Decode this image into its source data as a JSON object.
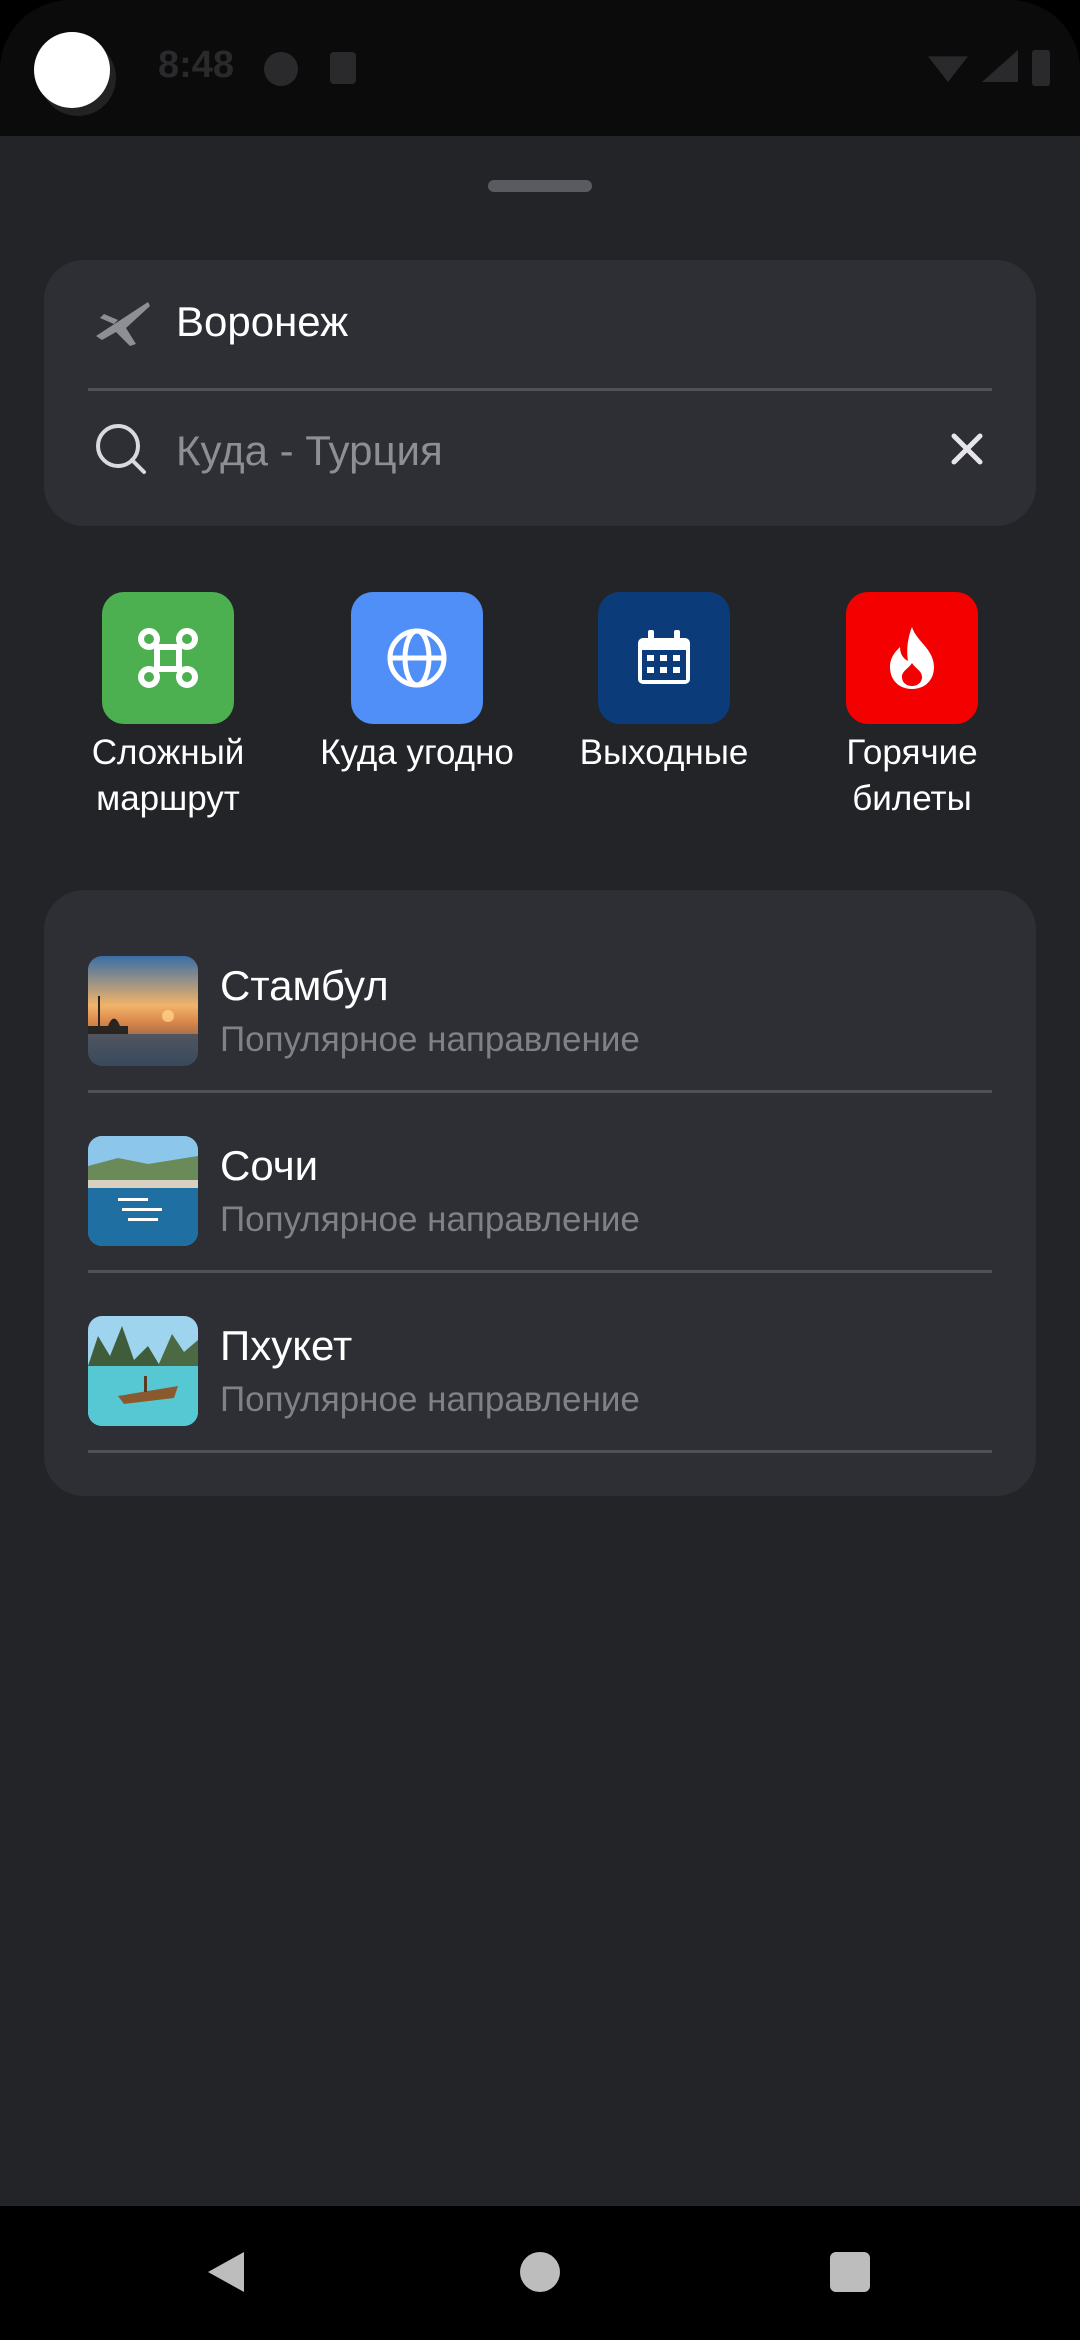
{
  "status_bar": {
    "time": "8:48"
  },
  "search": {
    "from_city": "Воронеж",
    "to_placeholder": "Куда - Турция",
    "to_value": ""
  },
  "quick_actions": [
    {
      "label": "Сложный маршрут",
      "icon": "command-icon",
      "color": "#4CAF50"
    },
    {
      "label": "Куда угодно",
      "icon": "globe-icon",
      "color": "#4F8FF7"
    },
    {
      "label": "Выходные",
      "icon": "calendar-icon",
      "color": "#0C3B7A"
    },
    {
      "label": "Горячие билеты",
      "icon": "fire-icon",
      "color": "#F40000"
    }
  ],
  "destinations": [
    {
      "name": "Стамбул",
      "subtitle": "Популярное направление"
    },
    {
      "name": "Сочи",
      "subtitle": "Популярное направление"
    },
    {
      "name": "Пхукет",
      "subtitle": "Популярное направление"
    }
  ],
  "colors": {
    "background": "#232428",
    "card": "#2E2F34",
    "secondary_text": "#808187"
  }
}
